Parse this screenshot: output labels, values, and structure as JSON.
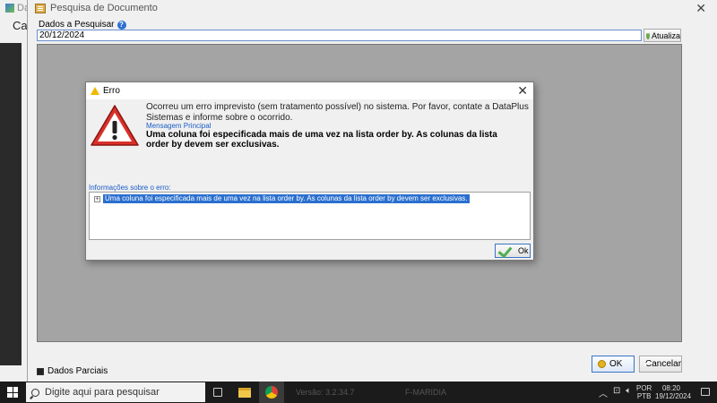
{
  "background_app": {
    "title_fragment": "Dat",
    "label_fragment": "Cada"
  },
  "search_window": {
    "title": "Pesquisa de Documento",
    "field_label": "Dados a Pesquisar",
    "date_value": "20/12/2024",
    "refresh_label": "Atualiza",
    "partial_label": "Dados Parciais",
    "ok_label": "OK",
    "cancel_label": "Cancelar"
  },
  "error_dialog": {
    "title": "Erro",
    "message": "Ocorreu um erro imprevisto (sem tratamento possível) no sistema. Por favor, contate a DataPlus Sistemas e informe sobre o ocorrido.",
    "main_message_label": "Mensagem Principal",
    "main_message": "Uma coluna foi especificada mais de uma vez na lista order by. As colunas da lista order by devem ser exclusivas.",
    "info_label": "Informações sobre o erro:",
    "tree_item": "Uma coluna foi especificada mais de uma vez na lista order by. As colunas da lista order by devem ser exclusivas.",
    "ok_label": "Ok"
  },
  "taskbar": {
    "search_placeholder": "Digite aqui para pesquisar",
    "faded_version": "Versão: 3.2.34.7",
    "faded_user": "F-MARIDIA",
    "lang_line1": "POR",
    "lang_line2": "PTB",
    "time": "08:20",
    "date": "19/12/2024"
  },
  "colors": {
    "accent": "#2a6fcf",
    "error_red": "#d9302a",
    "grid_gray": "#a4a4a4"
  }
}
